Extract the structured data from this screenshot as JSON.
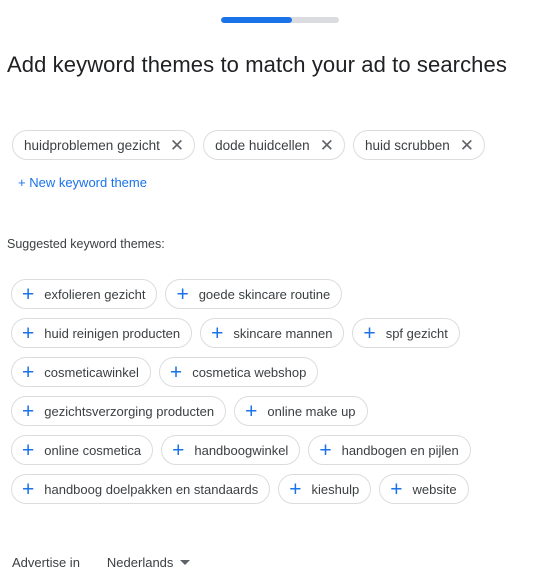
{
  "progress": {
    "fraction": 0.6
  },
  "title": "Add keyword themes to match your ad to searches",
  "selected_themes": [
    {
      "label": "huidproblemen gezicht",
      "remove_icon": "close-icon"
    },
    {
      "label": "dode huidcellen",
      "remove_icon": "close-icon"
    },
    {
      "label": "huid scrubben",
      "remove_icon": "close-icon"
    }
  ],
  "new_theme_link": "+ New keyword theme",
  "suggested_label": "Suggested keyword themes:",
  "suggested_rows": [
    [
      "exfolieren gezicht",
      "goede skincare routine"
    ],
    [
      "huid reinigen producten",
      "skincare mannen",
      "spf gezicht"
    ],
    [
      "cosmeticawinkel",
      "cosmetica webshop"
    ],
    [
      "gezichtsverzorging producten",
      "online make up"
    ],
    [
      "online cosmetica",
      "handboogwinkel",
      "handbogen en pijlen"
    ],
    [
      "handboog doelpakken en standaards",
      "kieshulp",
      "website"
    ]
  ],
  "footer": {
    "label": "Advertise in",
    "country": "Nederlands"
  },
  "colors": {
    "accent": "#1a73e8",
    "chip_border": "#dadce0",
    "text": "#202124"
  },
  "icons": {
    "add": "plus-icon",
    "remove": "close-icon",
    "dropdown": "caret-down-icon"
  }
}
